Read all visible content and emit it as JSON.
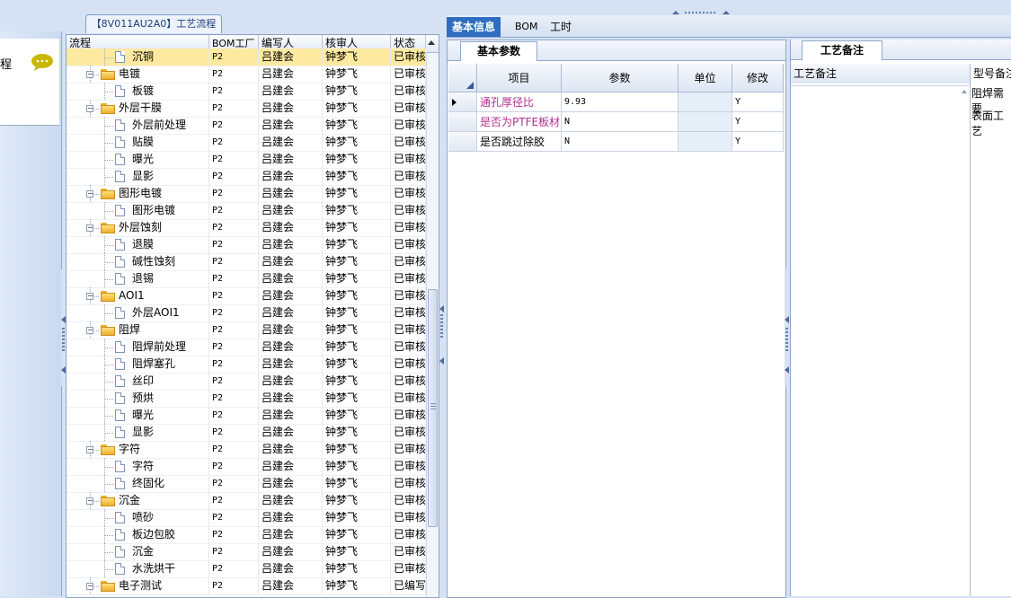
{
  "left_strip": {
    "label": "程"
  },
  "tree": {
    "title": "【8V011AU2A0】工艺流程",
    "headers": [
      "流程",
      "BOM工厂",
      "编写人",
      "核审人",
      "状态"
    ],
    "rows": [
      {
        "name": "沉铜",
        "level": 2,
        "type": "doc",
        "bom": "P2",
        "author": "吕建会",
        "reviewer": "钟梦飞",
        "status": "已审核",
        "selected": true
      },
      {
        "name": "电镀",
        "level": 1,
        "type": "folder",
        "bom": "P2",
        "author": "吕建会",
        "reviewer": "钟梦飞",
        "status": "已审核"
      },
      {
        "name": "板镀",
        "level": 2,
        "type": "doc",
        "bom": "P2",
        "author": "吕建会",
        "reviewer": "钟梦飞",
        "status": "已审核"
      },
      {
        "name": "外层干膜",
        "level": 1,
        "type": "folder",
        "bom": "P2",
        "author": "吕建会",
        "reviewer": "钟梦飞",
        "status": "已审核"
      },
      {
        "name": "外层前处理",
        "level": 2,
        "type": "doc",
        "bom": "P2",
        "author": "吕建会",
        "reviewer": "钟梦飞",
        "status": "已审核"
      },
      {
        "name": "贴膜",
        "level": 2,
        "type": "doc",
        "bom": "P2",
        "author": "吕建会",
        "reviewer": "钟梦飞",
        "status": "已审核"
      },
      {
        "name": "曝光",
        "level": 2,
        "type": "doc",
        "bom": "P2",
        "author": "吕建会",
        "reviewer": "钟梦飞",
        "status": "已审核"
      },
      {
        "name": "显影",
        "level": 2,
        "type": "doc",
        "bom": "P2",
        "author": "吕建会",
        "reviewer": "钟梦飞",
        "status": "已审核"
      },
      {
        "name": "图形电镀",
        "level": 1,
        "type": "folder",
        "bom": "P2",
        "author": "吕建会",
        "reviewer": "钟梦飞",
        "status": "已审核"
      },
      {
        "name": "图形电镀",
        "level": 2,
        "type": "doc",
        "bom": "P2",
        "author": "吕建会",
        "reviewer": "钟梦飞",
        "status": "已审核"
      },
      {
        "name": "外层蚀刻",
        "level": 1,
        "type": "folder",
        "bom": "P2",
        "author": "吕建会",
        "reviewer": "钟梦飞",
        "status": "已审核"
      },
      {
        "name": "退膜",
        "level": 2,
        "type": "doc",
        "bom": "P2",
        "author": "吕建会",
        "reviewer": "钟梦飞",
        "status": "已审核"
      },
      {
        "name": "碱性蚀刻",
        "level": 2,
        "type": "doc",
        "bom": "P2",
        "author": "吕建会",
        "reviewer": "钟梦飞",
        "status": "已审核"
      },
      {
        "name": "退锡",
        "level": 2,
        "type": "doc",
        "bom": "P2",
        "author": "吕建会",
        "reviewer": "钟梦飞",
        "status": "已审核"
      },
      {
        "name": "AOI1",
        "level": 1,
        "type": "folder",
        "bom": "P2",
        "author": "吕建会",
        "reviewer": "钟梦飞",
        "status": "已审核"
      },
      {
        "name": "外层AOI1",
        "level": 2,
        "type": "doc",
        "bom": "P2",
        "author": "吕建会",
        "reviewer": "钟梦飞",
        "status": "已审核"
      },
      {
        "name": "阻焊",
        "level": 1,
        "type": "folder",
        "bom": "P2",
        "author": "吕建会",
        "reviewer": "钟梦飞",
        "status": "已审核"
      },
      {
        "name": "阻焊前处理",
        "level": 2,
        "type": "doc",
        "bom": "P2",
        "author": "吕建会",
        "reviewer": "钟梦飞",
        "status": "已审核"
      },
      {
        "name": "阻焊塞孔",
        "level": 2,
        "type": "doc",
        "bom": "P2",
        "author": "吕建会",
        "reviewer": "钟梦飞",
        "status": "已审核"
      },
      {
        "name": "丝印",
        "level": 2,
        "type": "doc",
        "bom": "P2",
        "author": "吕建会",
        "reviewer": "钟梦飞",
        "status": "已审核"
      },
      {
        "name": "预烘",
        "level": 2,
        "type": "doc",
        "bom": "P2",
        "author": "吕建会",
        "reviewer": "钟梦飞",
        "status": "已审核"
      },
      {
        "name": "曝光",
        "level": 2,
        "type": "doc",
        "bom": "P2",
        "author": "吕建会",
        "reviewer": "钟梦飞",
        "status": "已审核"
      },
      {
        "name": "显影",
        "level": 2,
        "type": "doc",
        "bom": "P2",
        "author": "吕建会",
        "reviewer": "钟梦飞",
        "status": "已审核"
      },
      {
        "name": "字符",
        "level": 1,
        "type": "folder",
        "bom": "P2",
        "author": "吕建会",
        "reviewer": "钟梦飞",
        "status": "已审核"
      },
      {
        "name": "字符",
        "level": 2,
        "type": "doc",
        "bom": "P2",
        "author": "吕建会",
        "reviewer": "钟梦飞",
        "status": "已审核"
      },
      {
        "name": "终固化",
        "level": 2,
        "type": "doc",
        "bom": "P2",
        "author": "吕建会",
        "reviewer": "钟梦飞",
        "status": "已审核"
      },
      {
        "name": "沉金",
        "level": 1,
        "type": "folder",
        "bom": "P2",
        "author": "吕建会",
        "reviewer": "钟梦飞",
        "status": "已审核"
      },
      {
        "name": "喷砂",
        "level": 2,
        "type": "doc",
        "bom": "P2",
        "author": "吕建会",
        "reviewer": "钟梦飞",
        "status": "已审核"
      },
      {
        "name": "板边包胶",
        "level": 2,
        "type": "doc",
        "bom": "P2",
        "author": "吕建会",
        "reviewer": "钟梦飞",
        "status": "已审核"
      },
      {
        "name": "沉金",
        "level": 2,
        "type": "doc",
        "bom": "P2",
        "author": "吕建会",
        "reviewer": "钟梦飞",
        "status": "已审核"
      },
      {
        "name": "水洗烘干",
        "level": 2,
        "type": "doc",
        "bom": "P2",
        "author": "吕建会",
        "reviewer": "钟梦飞",
        "status": "已审核"
      },
      {
        "name": "电子测试",
        "level": 1,
        "type": "folder",
        "bom": "P2",
        "author": "吕建会",
        "reviewer": "钟梦飞",
        "status": "已编写"
      }
    ]
  },
  "main_tabs": [
    "基本信息",
    "BOM",
    "工时"
  ],
  "basic": {
    "subtab": "基本参数",
    "headers": [
      "项目",
      "参数",
      "单位",
      "修改"
    ],
    "rows": [
      {
        "item": "通孔厚径比",
        "param": "9.93",
        "unit": "",
        "modify": "Y",
        "highlight": true
      },
      {
        "item": "是否为PTFE板材",
        "param": "N",
        "unit": "",
        "modify": "Y",
        "highlight": true
      },
      {
        "item": "是否跳过除胶",
        "param": "N",
        "unit": "",
        "modify": "Y",
        "highlight": false
      }
    ]
  },
  "notes": {
    "subtab": "工艺备注",
    "col1": "工艺备注",
    "col2": "型号备注",
    "col2_values": [
      "阻焊需要",
      "表面工艺"
    ]
  }
}
